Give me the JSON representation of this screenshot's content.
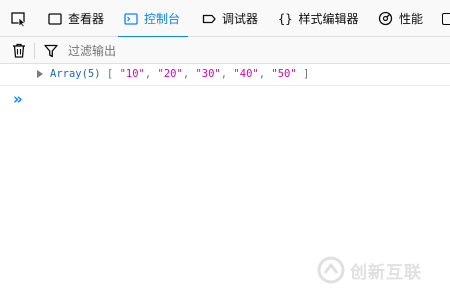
{
  "toolbar": {
    "accent_color": "#0a84ff",
    "tabs": [
      {
        "label": "查看器",
        "icon": "inspector-icon"
      },
      {
        "label": "控制台",
        "icon": "console-icon",
        "active": true
      },
      {
        "label": "调试器",
        "icon": "debugger-icon"
      },
      {
        "label": "样式编辑器",
        "icon": "style-editor-icon"
      },
      {
        "label": "性能",
        "icon": "performance-icon"
      }
    ]
  },
  "filter": {
    "placeholder": "过滤输出"
  },
  "console": {
    "log": {
      "title": "Array(5)",
      "open_bracket": "[",
      "close_bracket": "]",
      "items": [
        "\"10\"",
        "\"20\"",
        "\"30\"",
        "\"40\"",
        "\"50\""
      ],
      "separator": ", "
    },
    "prompt": "»"
  },
  "watermark": {
    "text": "创新互联"
  }
}
